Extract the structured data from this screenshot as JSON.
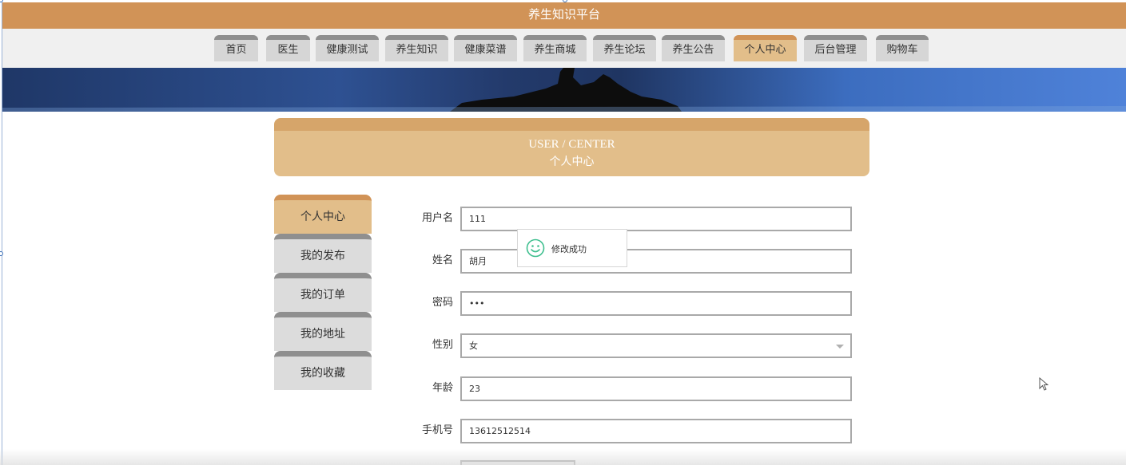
{
  "header": {
    "title": "养生知识平台"
  },
  "nav": {
    "items": [
      {
        "label": "首页",
        "active": false
      },
      {
        "label": "医生",
        "active": false
      },
      {
        "label": "健康测试",
        "active": false
      },
      {
        "label": "养生知识",
        "active": false
      },
      {
        "label": "健康菜谱",
        "active": false
      },
      {
        "label": "养生商城",
        "active": false
      },
      {
        "label": "养生论坛",
        "active": false
      },
      {
        "label": "养生公告",
        "active": false
      },
      {
        "label": "个人中心",
        "active": true
      },
      {
        "label": "后台管理",
        "active": false
      },
      {
        "label": "购物车",
        "active": false
      }
    ]
  },
  "user_center": {
    "title_en": "USER / CENTER",
    "title_cn": "个人中心"
  },
  "side_menu": {
    "items": [
      {
        "label": "个人中心",
        "active": true
      },
      {
        "label": "我的发布",
        "active": false
      },
      {
        "label": "我的订单",
        "active": false
      },
      {
        "label": "我的地址",
        "active": false
      },
      {
        "label": "我的收藏",
        "active": false
      }
    ]
  },
  "form": {
    "username": {
      "label": "用户名",
      "value": "111"
    },
    "name": {
      "label": "姓名",
      "value": "胡月"
    },
    "password": {
      "label": "密码",
      "value": "•••"
    },
    "gender": {
      "label": "性别",
      "value": "女"
    },
    "age": {
      "label": "年龄",
      "value": "23"
    },
    "phone": {
      "label": "手机号",
      "value": "13612512514"
    }
  },
  "toast": {
    "message": "修改成功",
    "icon": "smile-icon"
  },
  "colors": {
    "brand": "#d19357",
    "active_tab": "#e2be8a",
    "inactive_tab": "#d6d6d6",
    "success_icon": "#3fbf8f"
  }
}
